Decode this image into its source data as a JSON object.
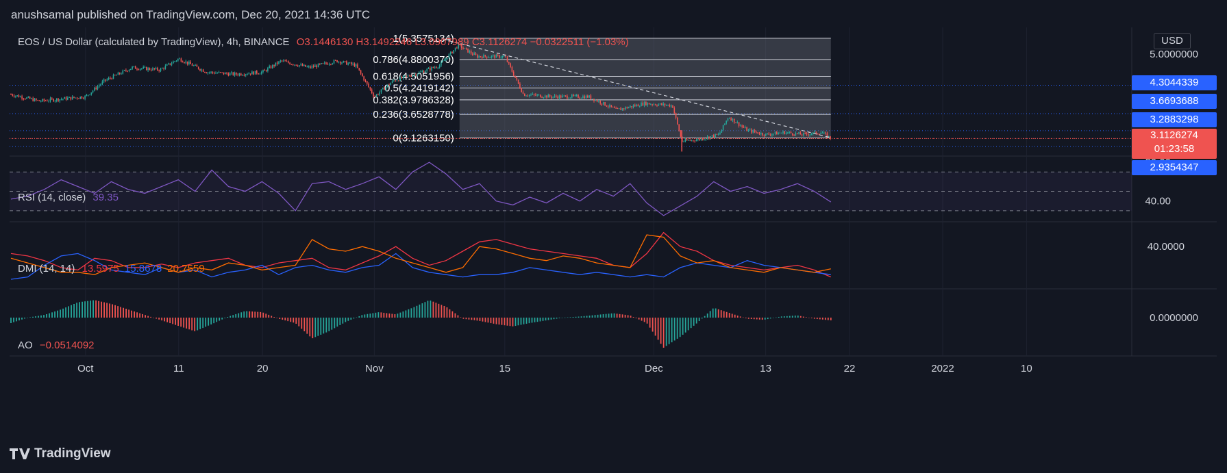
{
  "header": {
    "published": "anushsamal published on TradingView.com, Dec 20, 2021 14:36 UTC"
  },
  "footer": {
    "brand": "TradingView",
    "logo_icon": "tradingview-logo-icon"
  },
  "colors": {
    "background": "#131722",
    "grid": "#1e2230",
    "up": "#26a69a",
    "down": "#ef5350",
    "rsi": "#7e57c2",
    "dmi_plus": "#f23645",
    "dmi_minus": "#2962ff",
    "adx": "#ff6d00",
    "fib_line": "#d1d4dc",
    "price_line": "#ef5350"
  },
  "chart_data": [
    {
      "type": "candlestick",
      "symbol_legend": "EOS / US Dollar (calculated by TradingView), 4h, BINANCE",
      "ohlc": {
        "O": "O3.1446130",
        "H": "H3.1492246",
        "L": "L3.0907989",
        "C": "C3.1126274",
        "change": "−0.0322511 (−1.03%)"
      },
      "currency": "USD",
      "y_tick_labels": [
        "5.0000000"
      ],
      "ylim": [
        2.75,
        5.6
      ],
      "x_tick_labels": [
        "Oct",
        "11",
        "20",
        "Nov",
        "15",
        "Dec",
        "13",
        "22",
        "2022",
        "10"
      ],
      "fibonacci": [
        {
          "level": "1",
          "value": "5.3575134"
        },
        {
          "level": "0.786",
          "value": "4.8800370"
        },
        {
          "level": "0.618",
          "value": "4.5051956"
        },
        {
          "level": "0.5",
          "value": "4.2419142"
        },
        {
          "level": "0.382",
          "value": "3.9786328"
        },
        {
          "level": "0.236",
          "value": "3.6528778"
        },
        {
          "level": "0",
          "value": "3.1263150"
        }
      ],
      "price_tags": [
        {
          "value": "4.3044339",
          "color": "#2962ff"
        },
        {
          "value": "3.6693688",
          "color": "#2962ff"
        },
        {
          "value": "3.2883298",
          "color": "#2962ff"
        },
        {
          "value": "3.1126274",
          "sub": "01:23:58",
          "color": "#ef5350"
        },
        {
          "value": "2.9354347",
          "color": "#2962ff"
        }
      ],
      "price_path": [
        [
          "Sep 23",
          4.1
        ],
        [
          "Sep 26",
          3.95
        ],
        [
          "Oct 1",
          4.05
        ],
        [
          "Oct 3",
          4.4
        ],
        [
          "Oct 6",
          4.7
        ],
        [
          "Oct 9",
          4.65
        ],
        [
          "Oct 11",
          4.9
        ],
        [
          "Oct 14",
          4.6
        ],
        [
          "Oct 17",
          4.55
        ],
        [
          "Oct 20",
          4.6
        ],
        [
          "Oct 22",
          4.85
        ],
        [
          "Oct 25",
          4.7
        ],
        [
          "Oct 28",
          4.85
        ],
        [
          "Oct 30",
          4.75
        ],
        [
          "Nov 1",
          4.05
        ],
        [
          "Nov 3",
          4.4
        ],
        [
          "Nov 6",
          4.6
        ],
        [
          "Nov 8",
          4.75
        ],
        [
          "Nov 10",
          5.2
        ],
        [
          "Nov 12",
          4.95
        ],
        [
          "Nov 15",
          4.95
        ],
        [
          "Nov 17",
          4.1
        ],
        [
          "Nov 20",
          4.05
        ],
        [
          "Nov 24",
          4.05
        ],
        [
          "Nov 27",
          3.75
        ],
        [
          "Nov 30",
          3.9
        ],
        [
          "Dec 3",
          3.85
        ],
        [
          "Dec 4",
          3.05
        ],
        [
          "Dec 6",
          3.1
        ],
        [
          "Dec 8",
          3.2
        ],
        [
          "Dec 9",
          3.6
        ],
        [
          "Dec 11",
          3.3
        ],
        [
          "Dec 13",
          3.2
        ],
        [
          "Dec 15",
          3.25
        ],
        [
          "Dec 17",
          3.2
        ],
        [
          "Dec 19",
          3.25
        ],
        [
          "Dec 20",
          3.11
        ]
      ]
    },
    {
      "type": "line",
      "legend": "RSI (14, close)",
      "value": "39.35",
      "y_tick_labels": [
        "80.00",
        "40.00"
      ],
      "levels": [
        70,
        50,
        30
      ],
      "ylim": [
        20,
        85
      ],
      "series": [
        {
          "values": [
            42,
            45,
            52,
            62,
            55,
            48,
            60,
            52,
            48,
            55,
            62,
            50,
            72,
            55,
            50,
            60,
            48,
            30,
            58,
            60,
            52,
            58,
            65,
            52,
            70,
            80,
            68,
            52,
            58,
            40,
            36,
            44,
            38,
            48,
            40,
            52,
            45,
            58,
            38,
            25,
            35,
            45,
            60,
            50,
            55,
            48,
            52,
            58,
            50,
            39
          ]
        }
      ]
    },
    {
      "type": "line",
      "legend": "DMI (14, 14)",
      "values": [
        "13.5975",
        "15.8678",
        "20.7559"
      ],
      "y_tick_labels": [
        "40.0000"
      ],
      "ylim": [
        5,
        60
      ],
      "series": [
        {
          "values": [
            34,
            32,
            28,
            22,
            20,
            30,
            28,
            22,
            22,
            25,
            22,
            26,
            28,
            30,
            24,
            22,
            26,
            28,
            30,
            22,
            20,
            26,
            32,
            40,
            30,
            24,
            28,
            36,
            44,
            46,
            42,
            38,
            36,
            34,
            32,
            30,
            24,
            22,
            34,
            52,
            40,
            36,
            28,
            24,
            22,
            20,
            22,
            24,
            20,
            14
          ]
        },
        {
          "values": [
            12,
            14,
            24,
            32,
            34,
            28,
            20,
            18,
            16,
            22,
            18,
            20,
            14,
            18,
            20,
            24,
            16,
            22,
            24,
            20,
            18,
            22,
            24,
            34,
            22,
            18,
            16,
            14,
            16,
            16,
            18,
            22,
            20,
            18,
            16,
            18,
            16,
            14,
            16,
            14,
            22,
            26,
            24,
            22,
            28,
            24,
            22,
            20,
            18,
            16
          ]
        },
        {
          "values": [
            30,
            26,
            22,
            18,
            18,
            16,
            22,
            24,
            26,
            22,
            18,
            22,
            20,
            26,
            24,
            20,
            22,
            24,
            46,
            38,
            36,
            40,
            36,
            30,
            26,
            22,
            18,
            22,
            40,
            38,
            34,
            30,
            28,
            32,
            30,
            26,
            24,
            22,
            50,
            48,
            32,
            26,
            28,
            22,
            20,
            18,
            22,
            20,
            18,
            21
          ]
        }
      ]
    },
    {
      "type": "bar",
      "legend": "AO",
      "value": "−0.0514092",
      "y_tick_labels": [
        "0.0000000"
      ],
      "ylim": [
        -0.7,
        0.5
      ],
      "values": [
        -0.1,
        0.0,
        0.05,
        0.15,
        0.28,
        0.32,
        0.25,
        0.15,
        0.05,
        -0.05,
        -0.15,
        -0.25,
        -0.12,
        0.02,
        0.12,
        0.1,
        -0.02,
        -0.1,
        -0.38,
        -0.25,
        -0.08,
        0.05,
        0.1,
        0.06,
        0.18,
        0.32,
        0.2,
        -0.02,
        -0.06,
        -0.12,
        -0.16,
        -0.1,
        -0.05,
        0.0,
        0.02,
        0.05,
        0.08,
        0.04,
        -0.1,
        -0.55,
        -0.35,
        -0.1,
        0.18,
        0.08,
        -0.02,
        -0.04,
        0.02,
        0.04,
        -0.02,
        -0.05
      ]
    }
  ]
}
